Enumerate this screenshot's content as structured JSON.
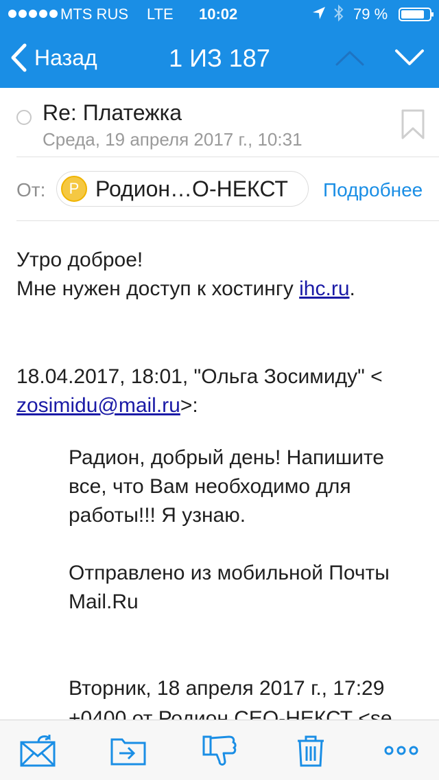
{
  "status_bar": {
    "carrier": "MTS RUS",
    "network": "LTE",
    "time": "10:02",
    "battery": "79 %"
  },
  "nav": {
    "back_label": "Назад",
    "counter": "1 ИЗ 187"
  },
  "message": {
    "subject": "Re: Платежка",
    "date": "Среда, 19 апреля 2017 г., 10:31",
    "from_label": "От:",
    "avatar_letter": "Р",
    "sender": "Родион…О-НЕКСТ",
    "details_link": "Подробнее"
  },
  "body": {
    "greeting": "Утро доброе!",
    "line2_prefix": "Мне нужен доступ к хостингу ",
    "line2_link": "ihc.ru",
    "line2_suffix": ".",
    "quote_header_1": "18.04.2017, 18:01, \"Ольга Зосимиду\" <",
    "quote_email": "zosimidu@mail.ru",
    "quote_header_2_suffix": ">:",
    "quote_lines": [
      "Радион, добрый день! Напишите",
      "все, что Вам необходимо для",
      "работы!!! Я узнаю."
    ],
    "signature_lines": [
      "Отправлено из мобильной Почты",
      "Mail.Ru"
    ],
    "quote2_line1": "Вторник, 18 апреля 2017 г., 17:29",
    "quote2_line2": "+0400 от Родион CEO-НЕКСТ <se"
  },
  "colors": {
    "accent": "#1a8ee5",
    "link": "#1a1aa6",
    "avatar": "#f5c842"
  },
  "toolbar": {
    "icons": [
      "reply-icon",
      "move-icon",
      "spam-icon",
      "trash-icon",
      "more-icon"
    ]
  }
}
